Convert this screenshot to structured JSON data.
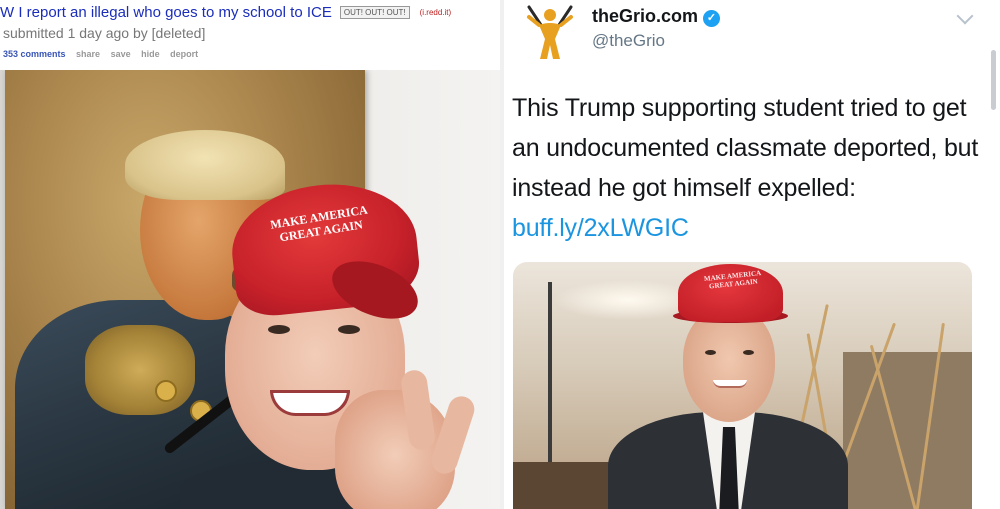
{
  "reddit": {
    "title_prefix": "W",
    "title": "I report an illegal who goes to my school to ICE",
    "flair": "OUT! OUT! OUT!",
    "domain": "(i.redd.it)",
    "meta": "submitted 1 day ago by [deleted]",
    "actions": {
      "comments": "353 comments",
      "share": "share",
      "save": "save",
      "hide": "hide",
      "report": "deport"
    },
    "photo": {
      "cap_text": "MAKE AMERICA GREAT AGAIN"
    }
  },
  "tweet": {
    "display_name": "theGrio.com",
    "verified_badge": "✓",
    "handle": "@theGrio",
    "text": "This Trump supporting student tried to get an undocumented classmate deported, but instead he got himself expelled: ",
    "link": "buff.ly/2xLWGIC",
    "photo": {
      "cap_text": "MAKE AMERICA GREAT AGAIN"
    }
  },
  "colors": {
    "reddit_link": "#1a2dbb",
    "twitter_blue": "#1da1f2",
    "tweet_link": "#1b95e0",
    "cap_red": "#c7212a"
  },
  "icons": [
    "verified-badge-icon",
    "chevron-down-icon",
    "thegrio-logo-icon"
  ]
}
